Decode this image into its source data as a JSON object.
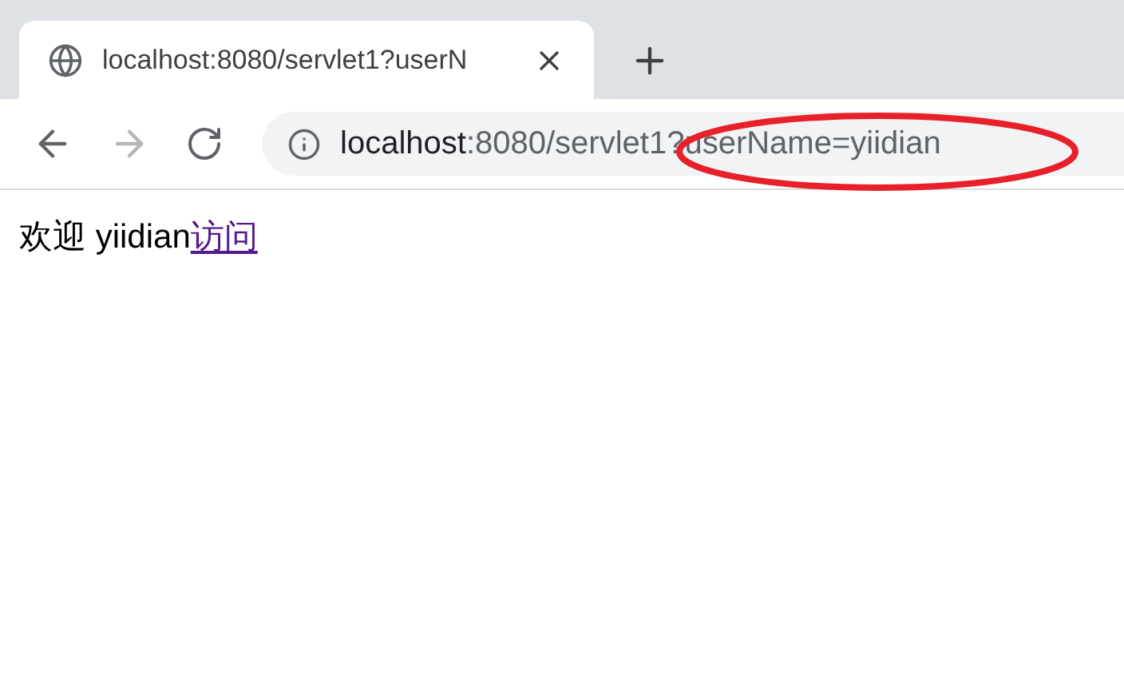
{
  "tabs": [
    {
      "title": "localhost:8080/servlet1?userN",
      "selected": true
    }
  ],
  "toolbar": {
    "back": {
      "disabled": false
    },
    "forward": {
      "disabled": true
    }
  },
  "address_bar": {
    "host": "localhost",
    "rest": ":8080/servlet1?userName=yiidian"
  },
  "annotation": {
    "kind": "ellipse",
    "color": "#e8202a"
  },
  "page": {
    "text": "欢迎 yiidian",
    "link": "访问"
  }
}
